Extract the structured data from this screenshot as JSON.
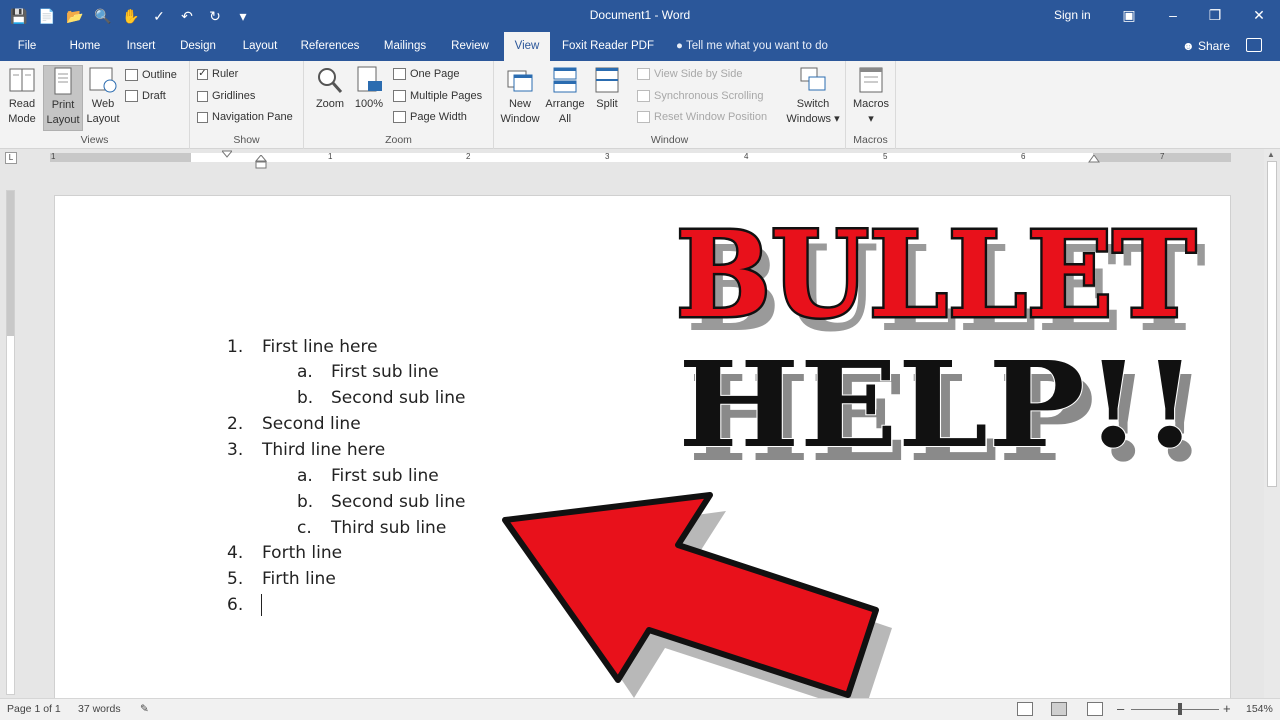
{
  "window": {
    "title": "Document1  -  Word",
    "sign_in": "Sign in",
    "share": "Share",
    "tell_me": "Tell me what you want to do"
  },
  "tabs": [
    "File",
    "Home",
    "Insert",
    "Design",
    "Layout",
    "References",
    "Mailings",
    "Review",
    "View",
    "Foxit Reader PDF"
  ],
  "active_tab": "View",
  "ribbon": {
    "views": {
      "label": "Views",
      "read_mode": [
        "Read",
        "Mode"
      ],
      "print_layout": [
        "Print",
        "Layout"
      ],
      "web_layout": [
        "Web",
        "Layout"
      ],
      "outline": "Outline",
      "draft": "Draft"
    },
    "show": {
      "label": "Show",
      "ruler": "Ruler",
      "gridlines": "Gridlines",
      "navigation_pane": "Navigation Pane",
      "ruler_checked": true
    },
    "zoom": {
      "label": "Zoom",
      "zoom": "Zoom",
      "hundred": "100%",
      "one_page": "One Page",
      "multiple_pages": "Multiple Pages",
      "page_width": "Page Width"
    },
    "window": {
      "label": "Window",
      "new_window": [
        "New",
        "Window"
      ],
      "arrange_all": [
        "Arrange",
        "All"
      ],
      "split": "Split",
      "view_side_by_side": "View Side by Side",
      "synchronous_scrolling": "Synchronous Scrolling",
      "reset_window_position": "Reset Window Position",
      "switch_windows": [
        "Switch",
        "Windows"
      ]
    },
    "macros": {
      "label": "Macros",
      "macros": "Macros"
    }
  },
  "ruler_numbers": [
    "1",
    "1",
    "2",
    "3",
    "4",
    "5",
    "6",
    "7"
  ],
  "document": {
    "lines": [
      {
        "marker": "1.",
        "text": "First line here"
      },
      {
        "marker": "a.",
        "text": "First sub line"
      },
      {
        "marker": "b.",
        "text": "Second sub line"
      },
      {
        "marker": "2.",
        "text": "Second line"
      },
      {
        "marker": "3.",
        "text": "Third line here"
      },
      {
        "marker": "a.",
        "text": "First sub line"
      },
      {
        "marker": "b.",
        "text": "Second sub line"
      },
      {
        "marker": "c.",
        "text": "Third sub line"
      },
      {
        "marker": "4.",
        "text": "Forth line"
      },
      {
        "marker": "5.",
        "text": "Firth line"
      },
      {
        "marker": "6.",
        "text": ""
      }
    ]
  },
  "overlay": {
    "line1": "BULLET",
    "line2": "HELP!!",
    "colors": {
      "red": "#e8111b",
      "black": "#111111",
      "shadow": "#8a8a8a"
    }
  },
  "status": {
    "page": "Page 1 of 1",
    "words": "37 words",
    "zoom": "154%"
  },
  "colors": {
    "brand": "#2b579a",
    "ribbon": "#f3f3f3",
    "canvas": "#e6e6e6"
  }
}
